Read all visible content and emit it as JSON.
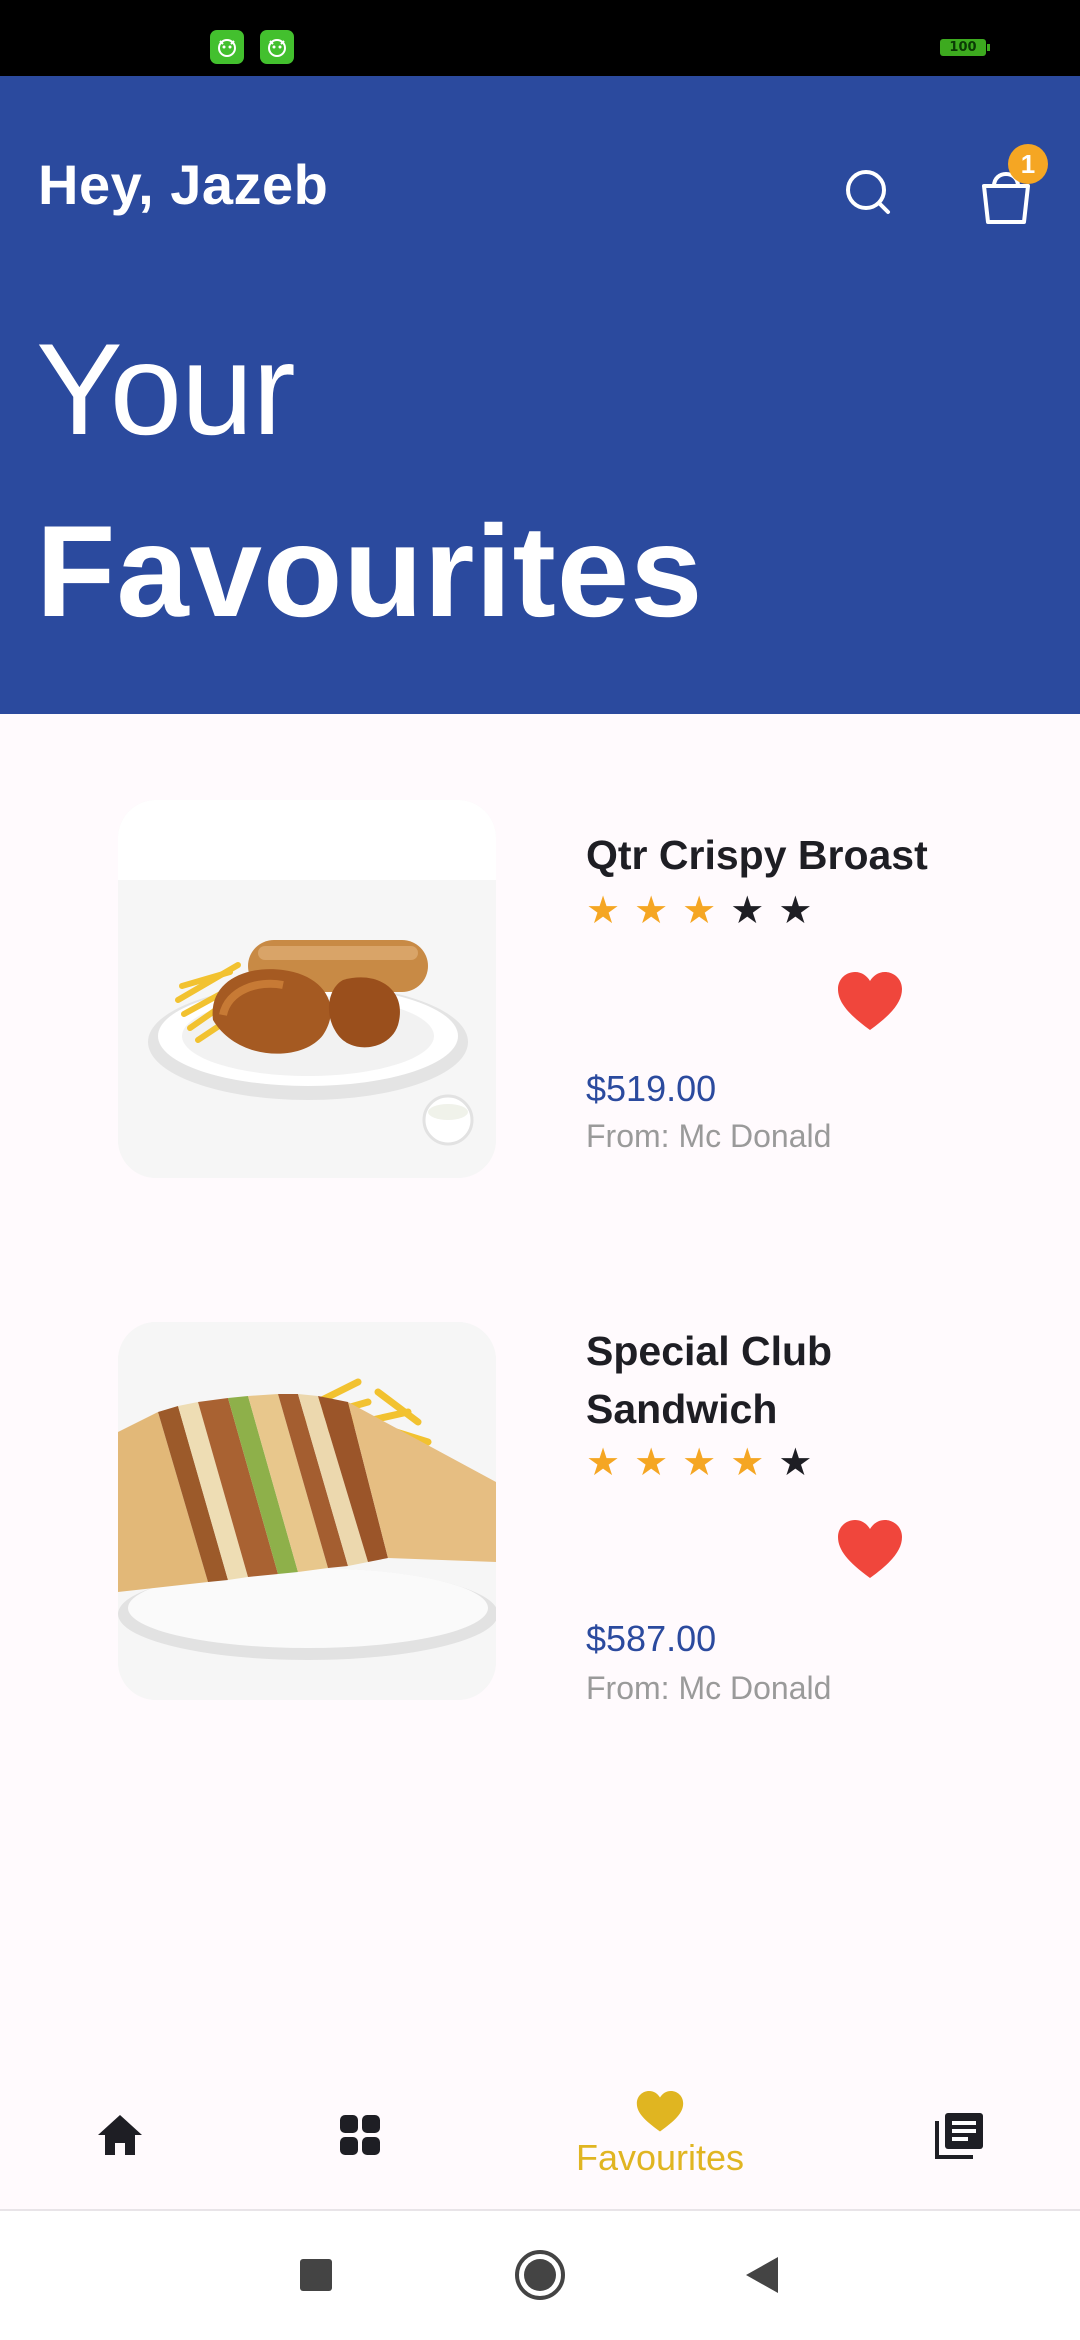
{
  "status_bar": {
    "battery_level": "100",
    "notification_icons": [
      "app-notification-icon",
      "app-notification-icon"
    ]
  },
  "header": {
    "greeting": "Hey, Jazeb",
    "cart_count": "1",
    "title_line1": "Your",
    "title_line2": "Favourites",
    "background_color": "#2B4A9E",
    "badge_color": "#F5A623"
  },
  "favourites": [
    {
      "name": "Qtr Crispy Broast",
      "rating": 3,
      "rating_max": 5,
      "price": "$519.00",
      "source": "From: Mc Donald",
      "favourited": true
    },
    {
      "name": "Special Club Sandwich",
      "rating": 4,
      "rating_max": 5,
      "price": "$587.00",
      "source": "From: Mc Donald",
      "favourited": true
    }
  ],
  "bottom_nav": {
    "items": [
      {
        "icon": "home-icon",
        "label": ""
      },
      {
        "icon": "grid-icon",
        "label": ""
      },
      {
        "icon": "heart-icon",
        "label": "Favourites",
        "active": true
      },
      {
        "icon": "orders-icon",
        "label": ""
      }
    ],
    "active_color": "#E0B521"
  },
  "system_nav": {
    "buttons": [
      "recents-icon",
      "home-circle-icon",
      "back-icon"
    ]
  },
  "colors": {
    "accent": "#2B4A9E",
    "star_on": "#F5A623",
    "heart": "#F0463C"
  }
}
